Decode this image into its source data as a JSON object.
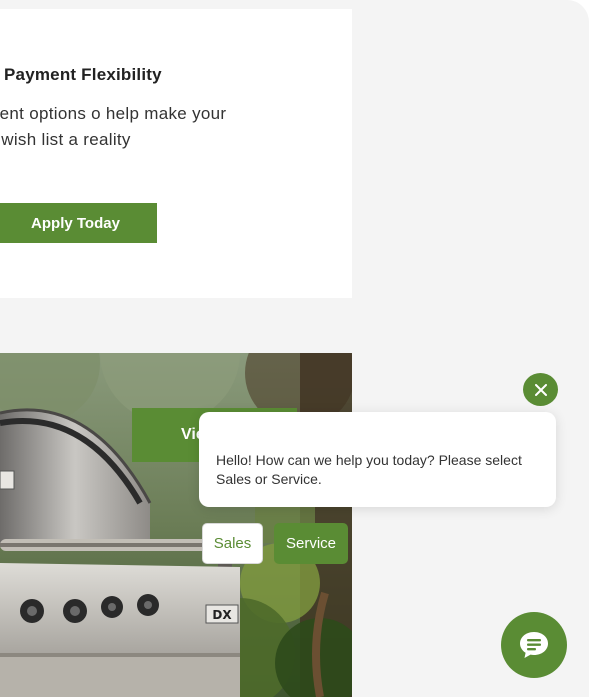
{
  "promo": {
    "title": "Payment Flexibility",
    "text": "exible payment options o help make your wish list a reality",
    "button_label": "Apply Today"
  },
  "hero": {
    "button_label": "View"
  },
  "chat": {
    "message": "Hello! How can we help you today? Please select Sales or Service.",
    "options": [
      {
        "label": "Sales"
      },
      {
        "label": "Service"
      }
    ],
    "close_icon": "close-icon",
    "launcher_icon": "chat-icon"
  },
  "colors": {
    "brand_green": "#5a8c34",
    "page_background": "#f4f4f4"
  }
}
